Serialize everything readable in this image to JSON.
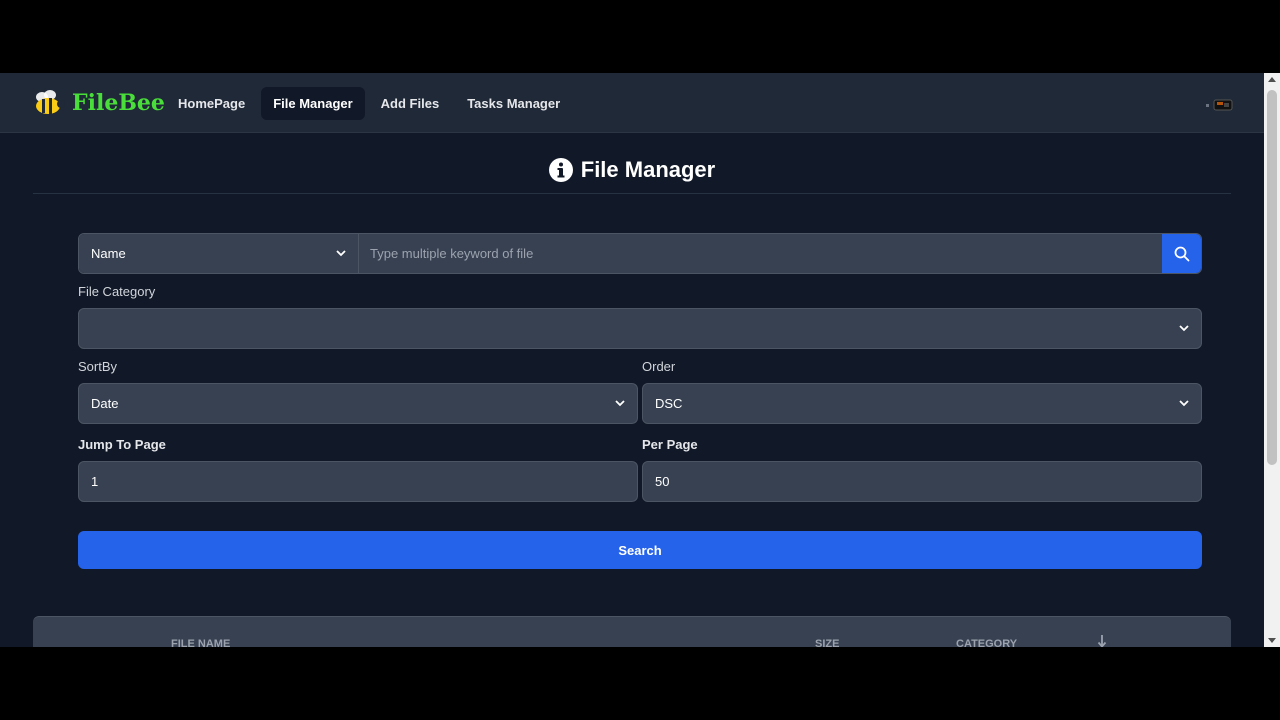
{
  "app": {
    "name": "FileBee"
  },
  "nav": {
    "items": [
      {
        "label": "HomePage"
      },
      {
        "label": "File Manager"
      },
      {
        "label": "Add Files"
      },
      {
        "label": "Tasks Manager"
      }
    ]
  },
  "page": {
    "title": "File Manager"
  },
  "search": {
    "field_select": "Name",
    "placeholder": "Type multiple keyword of file"
  },
  "filters": {
    "category_label": "File Category",
    "category_value": "",
    "sortby_label": "SortBy",
    "sortby_value": "Date",
    "order_label": "Order",
    "order_value": "DSC",
    "jump_label": "Jump To Page",
    "jump_value": "1",
    "perpage_label": "Per Page",
    "perpage_value": "50"
  },
  "search_button": "Search",
  "table": {
    "headers": [
      "FILE NAME",
      "SIZE",
      "CATEGORY"
    ]
  },
  "colors": {
    "brand": "#4ade3a",
    "accent": "#2563eb",
    "background": "#111827",
    "navbar": "#1f2937"
  }
}
